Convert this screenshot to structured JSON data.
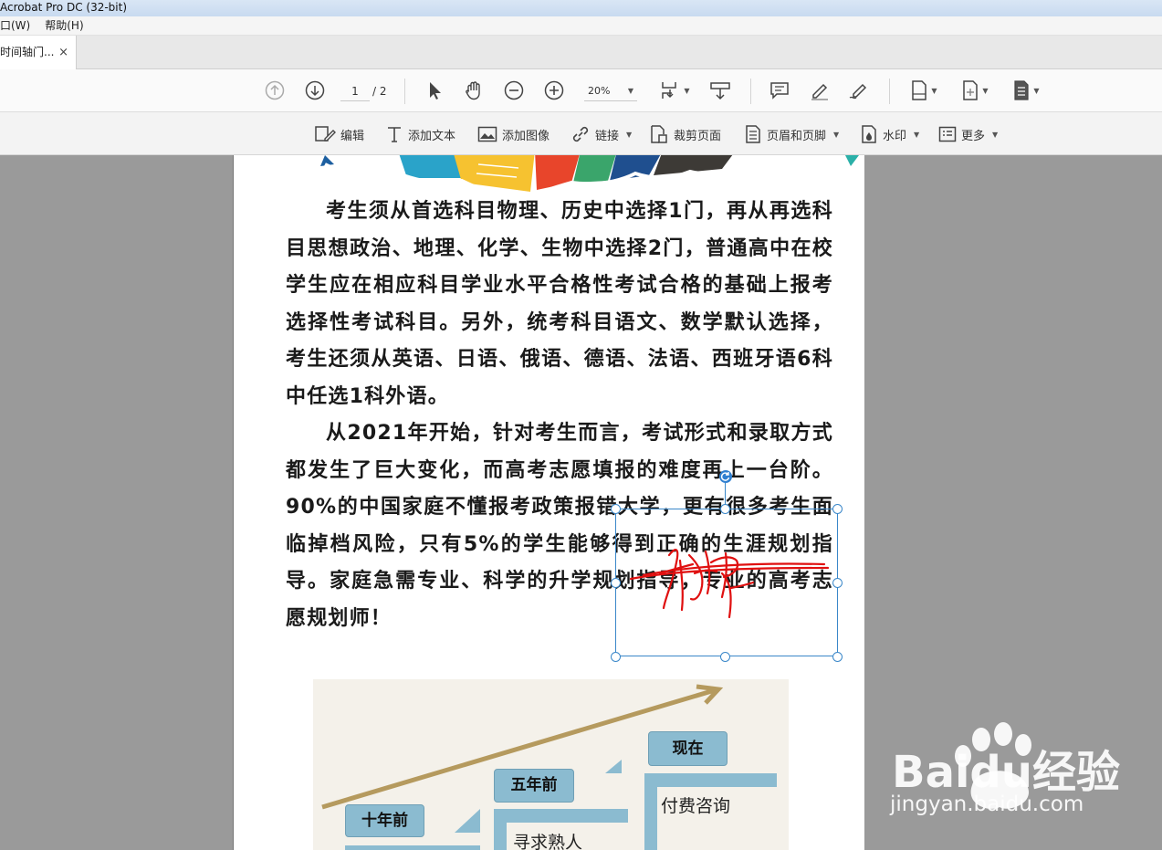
{
  "window": {
    "title": "Acrobat Pro DC (32-bit)"
  },
  "menu": {
    "items": [
      "口(W)",
      "帮助(H)"
    ]
  },
  "tab": {
    "label": "时间轴门...",
    "close": "×"
  },
  "toolbar": {
    "page_current": "1",
    "page_total": "/ 2",
    "zoom": "20%"
  },
  "edit_tools": {
    "edit": "编辑",
    "add_text": "添加文本",
    "add_image": "添加图像",
    "link": "链接",
    "crop": "裁剪页面",
    "header_footer": "页眉和页脚",
    "watermark": "水印",
    "more": "更多"
  },
  "document": {
    "paragraphs": [
      "考生须从首选科目物理、历史中选择1门，再从再选科目思想政治、地理、化学、生物中选择2门，普通高中在校学生应在相应科目学业水平合格性考试合格的基础上报考选择性考试科目。另外，统考科目语文、数学默认选择，考生还须从英语、日语、俄语、德语、法语、西班牙语6科中任选1科外语。",
      "从2021年开始，针对考生而言，考试形式和录取方式都发生了巨大变化，而高考志愿填报的难度再上一台阶。90%的中国家庭不懂报考政策报错大学，更有很多考生面临掉档风险，只有5%的学生能够得到正确的生涯规划指导。家庭急需专业、科学的升学规划指导，专业的高考志愿规划师！"
    ],
    "infographic": {
      "labels": [
        "十年前",
        "五年前",
        "现在"
      ],
      "texts": [
        "寻求熟人",
        "付费咨询"
      ]
    }
  },
  "watermark": {
    "brand": "Baidu经验",
    "url": "jingyan.baidu.com"
  },
  "colors": {
    "accent": "#3a87c9",
    "signature": "#e01010",
    "info_blue": "#8bbbd0",
    "arrow": "#b59a5e"
  }
}
